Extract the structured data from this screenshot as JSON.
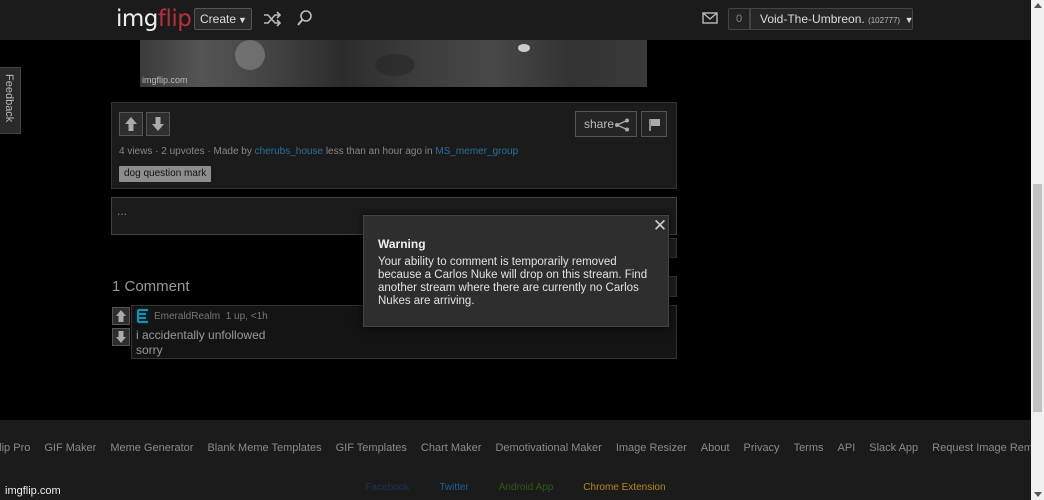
{
  "header": {
    "logo_main": "img",
    "logo_accent": "flip",
    "create_label": "Create",
    "notification_count": "0",
    "username": "Void-The-Umbreon.",
    "user_points": "(102777)"
  },
  "feedback": {
    "label": "Feedback"
  },
  "meme": {
    "watermark": "imgflip.com"
  },
  "post": {
    "share_label": "share",
    "views": "4 views",
    "upvotes": "2 upvotes",
    "made_by_prefix": "· Made by",
    "author": "cherubs_house",
    "time_text": "less than an hour ago in",
    "stream": "MS_memer_group",
    "tag": "dog question mark"
  },
  "comment_input": {
    "value": "..."
  },
  "comments": {
    "title": "1 Comment",
    "items": [
      {
        "user": "EmeraldRealm",
        "meta": "1 up, <1h",
        "line1": "i accidentally unfollowed",
        "line2": "sorry"
      }
    ]
  },
  "modal": {
    "title": "Warning",
    "body": "Your ability to comment is temporarily removed because a Carlos Nuke will drop on this stream. Find another stream where there are currently no Carlos Nukes are arriving."
  },
  "footer": {
    "links": [
      "Imgflip Pro",
      "GIF Maker",
      "Meme Generator",
      "Blank Meme Templates",
      "GIF Templates",
      "Chart Maker",
      "Demotivational Maker",
      "Image Resizer",
      "About",
      "Privacy",
      "Terms",
      "API",
      "Slack App",
      "Request Image Removal"
    ],
    "social": [
      {
        "label": "Facebook",
        "color": "#20315a"
      },
      {
        "label": "Twitter",
        "color": "#1e5f96"
      },
      {
        "label": "Android App",
        "color": "#2f5a17"
      },
      {
        "label": "Chrome Extension",
        "color": "#b58a1a"
      }
    ]
  },
  "site_label": "imgflip.com"
}
